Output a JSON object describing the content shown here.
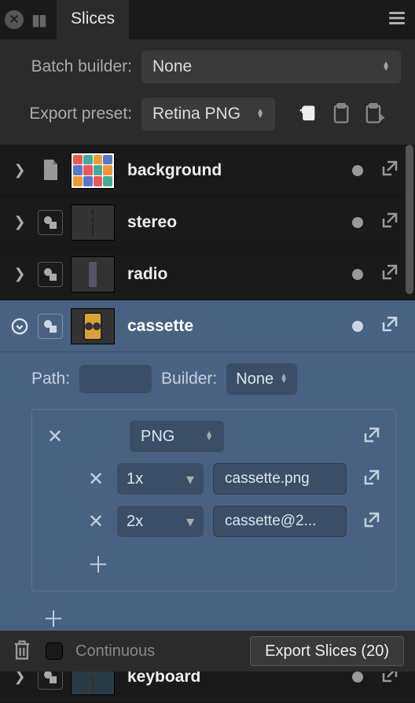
{
  "header": {
    "tab_title": "Slices"
  },
  "options": {
    "batch_label": "Batch builder:",
    "batch_value": "None",
    "preset_label": "Export preset:",
    "preset_value": "Retina PNG"
  },
  "slices": [
    {
      "name": "background",
      "icon": "page",
      "thumb": "bg"
    },
    {
      "name": "stereo",
      "icon": "layer",
      "thumb": "stereo"
    },
    {
      "name": "radio",
      "icon": "layer",
      "thumb": "radio"
    },
    {
      "name": "cassette",
      "icon": "layer",
      "thumb": "cassette",
      "selected": true
    },
    {
      "name": "keyboard",
      "icon": "layer",
      "thumb": "keyboard"
    }
  ],
  "expanded": {
    "path_label": "Path:",
    "path_value": "",
    "builder_label": "Builder:",
    "builder_value": "None",
    "format": "PNG",
    "rows": [
      {
        "scale": "1x",
        "filename": "cassette.png"
      },
      {
        "scale": "2x",
        "filename": "cassette@2..."
      }
    ]
  },
  "footer": {
    "continuous_label": "Continuous",
    "export_label": "Export Slices (20)"
  }
}
